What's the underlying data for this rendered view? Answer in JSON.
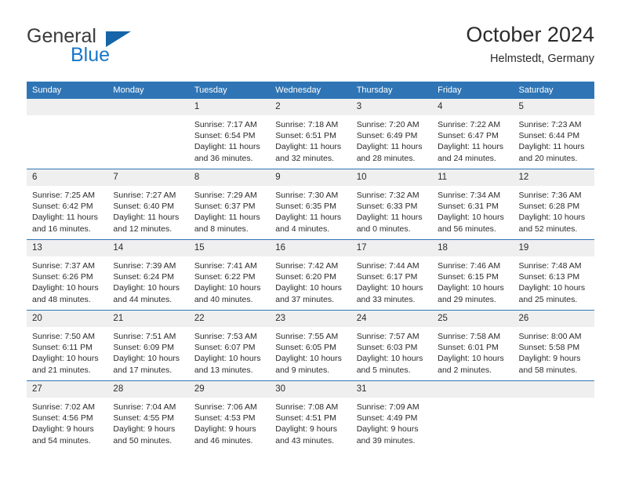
{
  "brand": {
    "line1": "General",
    "line2": "Blue",
    "accent_color": "#1565a8",
    "blue_text_color": "#1976c8"
  },
  "header": {
    "title": "October 2024",
    "location": "Helmstedt, Germany"
  },
  "theme": {
    "header_row_bg": "#2f75b5",
    "daynum_bg": "#efefef",
    "grid_line": "#2f75b5",
    "text": "#2b2b2b"
  },
  "weekday_headers": [
    "Sunday",
    "Monday",
    "Tuesday",
    "Wednesday",
    "Thursday",
    "Friday",
    "Saturday"
  ],
  "labels": {
    "sunrise_prefix": "Sunrise:",
    "sunset_prefix": "Sunset:",
    "daylight_prefix": "Daylight:"
  },
  "weeks": [
    [
      {
        "empty": true
      },
      {
        "empty": true
      },
      {
        "day": "1",
        "sunrise": "Sunrise: 7:17 AM",
        "sunset": "Sunset: 6:54 PM",
        "daylight_1": "Daylight: 11 hours",
        "daylight_2": "and 36 minutes."
      },
      {
        "day": "2",
        "sunrise": "Sunrise: 7:18 AM",
        "sunset": "Sunset: 6:51 PM",
        "daylight_1": "Daylight: 11 hours",
        "daylight_2": "and 32 minutes."
      },
      {
        "day": "3",
        "sunrise": "Sunrise: 7:20 AM",
        "sunset": "Sunset: 6:49 PM",
        "daylight_1": "Daylight: 11 hours",
        "daylight_2": "and 28 minutes."
      },
      {
        "day": "4",
        "sunrise": "Sunrise: 7:22 AM",
        "sunset": "Sunset: 6:47 PM",
        "daylight_1": "Daylight: 11 hours",
        "daylight_2": "and 24 minutes."
      },
      {
        "day": "5",
        "sunrise": "Sunrise: 7:23 AM",
        "sunset": "Sunset: 6:44 PM",
        "daylight_1": "Daylight: 11 hours",
        "daylight_2": "and 20 minutes."
      }
    ],
    [
      {
        "day": "6",
        "sunrise": "Sunrise: 7:25 AM",
        "sunset": "Sunset: 6:42 PM",
        "daylight_1": "Daylight: 11 hours",
        "daylight_2": "and 16 minutes."
      },
      {
        "day": "7",
        "sunrise": "Sunrise: 7:27 AM",
        "sunset": "Sunset: 6:40 PM",
        "daylight_1": "Daylight: 11 hours",
        "daylight_2": "and 12 minutes."
      },
      {
        "day": "8",
        "sunrise": "Sunrise: 7:29 AM",
        "sunset": "Sunset: 6:37 PM",
        "daylight_1": "Daylight: 11 hours",
        "daylight_2": "and 8 minutes."
      },
      {
        "day": "9",
        "sunrise": "Sunrise: 7:30 AM",
        "sunset": "Sunset: 6:35 PM",
        "daylight_1": "Daylight: 11 hours",
        "daylight_2": "and 4 minutes."
      },
      {
        "day": "10",
        "sunrise": "Sunrise: 7:32 AM",
        "sunset": "Sunset: 6:33 PM",
        "daylight_1": "Daylight: 11 hours",
        "daylight_2": "and 0 minutes."
      },
      {
        "day": "11",
        "sunrise": "Sunrise: 7:34 AM",
        "sunset": "Sunset: 6:31 PM",
        "daylight_1": "Daylight: 10 hours",
        "daylight_2": "and 56 minutes."
      },
      {
        "day": "12",
        "sunrise": "Sunrise: 7:36 AM",
        "sunset": "Sunset: 6:28 PM",
        "daylight_1": "Daylight: 10 hours",
        "daylight_2": "and 52 minutes."
      }
    ],
    [
      {
        "day": "13",
        "sunrise": "Sunrise: 7:37 AM",
        "sunset": "Sunset: 6:26 PM",
        "daylight_1": "Daylight: 10 hours",
        "daylight_2": "and 48 minutes."
      },
      {
        "day": "14",
        "sunrise": "Sunrise: 7:39 AM",
        "sunset": "Sunset: 6:24 PM",
        "daylight_1": "Daylight: 10 hours",
        "daylight_2": "and 44 minutes."
      },
      {
        "day": "15",
        "sunrise": "Sunrise: 7:41 AM",
        "sunset": "Sunset: 6:22 PM",
        "daylight_1": "Daylight: 10 hours",
        "daylight_2": "and 40 minutes."
      },
      {
        "day": "16",
        "sunrise": "Sunrise: 7:42 AM",
        "sunset": "Sunset: 6:20 PM",
        "daylight_1": "Daylight: 10 hours",
        "daylight_2": "and 37 minutes."
      },
      {
        "day": "17",
        "sunrise": "Sunrise: 7:44 AM",
        "sunset": "Sunset: 6:17 PM",
        "daylight_1": "Daylight: 10 hours",
        "daylight_2": "and 33 minutes."
      },
      {
        "day": "18",
        "sunrise": "Sunrise: 7:46 AM",
        "sunset": "Sunset: 6:15 PM",
        "daylight_1": "Daylight: 10 hours",
        "daylight_2": "and 29 minutes."
      },
      {
        "day": "19",
        "sunrise": "Sunrise: 7:48 AM",
        "sunset": "Sunset: 6:13 PM",
        "daylight_1": "Daylight: 10 hours",
        "daylight_2": "and 25 minutes."
      }
    ],
    [
      {
        "day": "20",
        "sunrise": "Sunrise: 7:50 AM",
        "sunset": "Sunset: 6:11 PM",
        "daylight_1": "Daylight: 10 hours",
        "daylight_2": "and 21 minutes."
      },
      {
        "day": "21",
        "sunrise": "Sunrise: 7:51 AM",
        "sunset": "Sunset: 6:09 PM",
        "daylight_1": "Daylight: 10 hours",
        "daylight_2": "and 17 minutes."
      },
      {
        "day": "22",
        "sunrise": "Sunrise: 7:53 AM",
        "sunset": "Sunset: 6:07 PM",
        "daylight_1": "Daylight: 10 hours",
        "daylight_2": "and 13 minutes."
      },
      {
        "day": "23",
        "sunrise": "Sunrise: 7:55 AM",
        "sunset": "Sunset: 6:05 PM",
        "daylight_1": "Daylight: 10 hours",
        "daylight_2": "and 9 minutes."
      },
      {
        "day": "24",
        "sunrise": "Sunrise: 7:57 AM",
        "sunset": "Sunset: 6:03 PM",
        "daylight_1": "Daylight: 10 hours",
        "daylight_2": "and 5 minutes."
      },
      {
        "day": "25",
        "sunrise": "Sunrise: 7:58 AM",
        "sunset": "Sunset: 6:01 PM",
        "daylight_1": "Daylight: 10 hours",
        "daylight_2": "and 2 minutes."
      },
      {
        "day": "26",
        "sunrise": "Sunrise: 8:00 AM",
        "sunset": "Sunset: 5:58 PM",
        "daylight_1": "Daylight: 9 hours",
        "daylight_2": "and 58 minutes."
      }
    ],
    [
      {
        "day": "27",
        "sunrise": "Sunrise: 7:02 AM",
        "sunset": "Sunset: 4:56 PM",
        "daylight_1": "Daylight: 9 hours",
        "daylight_2": "and 54 minutes."
      },
      {
        "day": "28",
        "sunrise": "Sunrise: 7:04 AM",
        "sunset": "Sunset: 4:55 PM",
        "daylight_1": "Daylight: 9 hours",
        "daylight_2": "and 50 minutes."
      },
      {
        "day": "29",
        "sunrise": "Sunrise: 7:06 AM",
        "sunset": "Sunset: 4:53 PM",
        "daylight_1": "Daylight: 9 hours",
        "daylight_2": "and 46 minutes."
      },
      {
        "day": "30",
        "sunrise": "Sunrise: 7:08 AM",
        "sunset": "Sunset: 4:51 PM",
        "daylight_1": "Daylight: 9 hours",
        "daylight_2": "and 43 minutes."
      },
      {
        "day": "31",
        "sunrise": "Sunrise: 7:09 AM",
        "sunset": "Sunset: 4:49 PM",
        "daylight_1": "Daylight: 9 hours",
        "daylight_2": "and 39 minutes."
      },
      {
        "empty": true
      },
      {
        "empty": true
      }
    ]
  ]
}
